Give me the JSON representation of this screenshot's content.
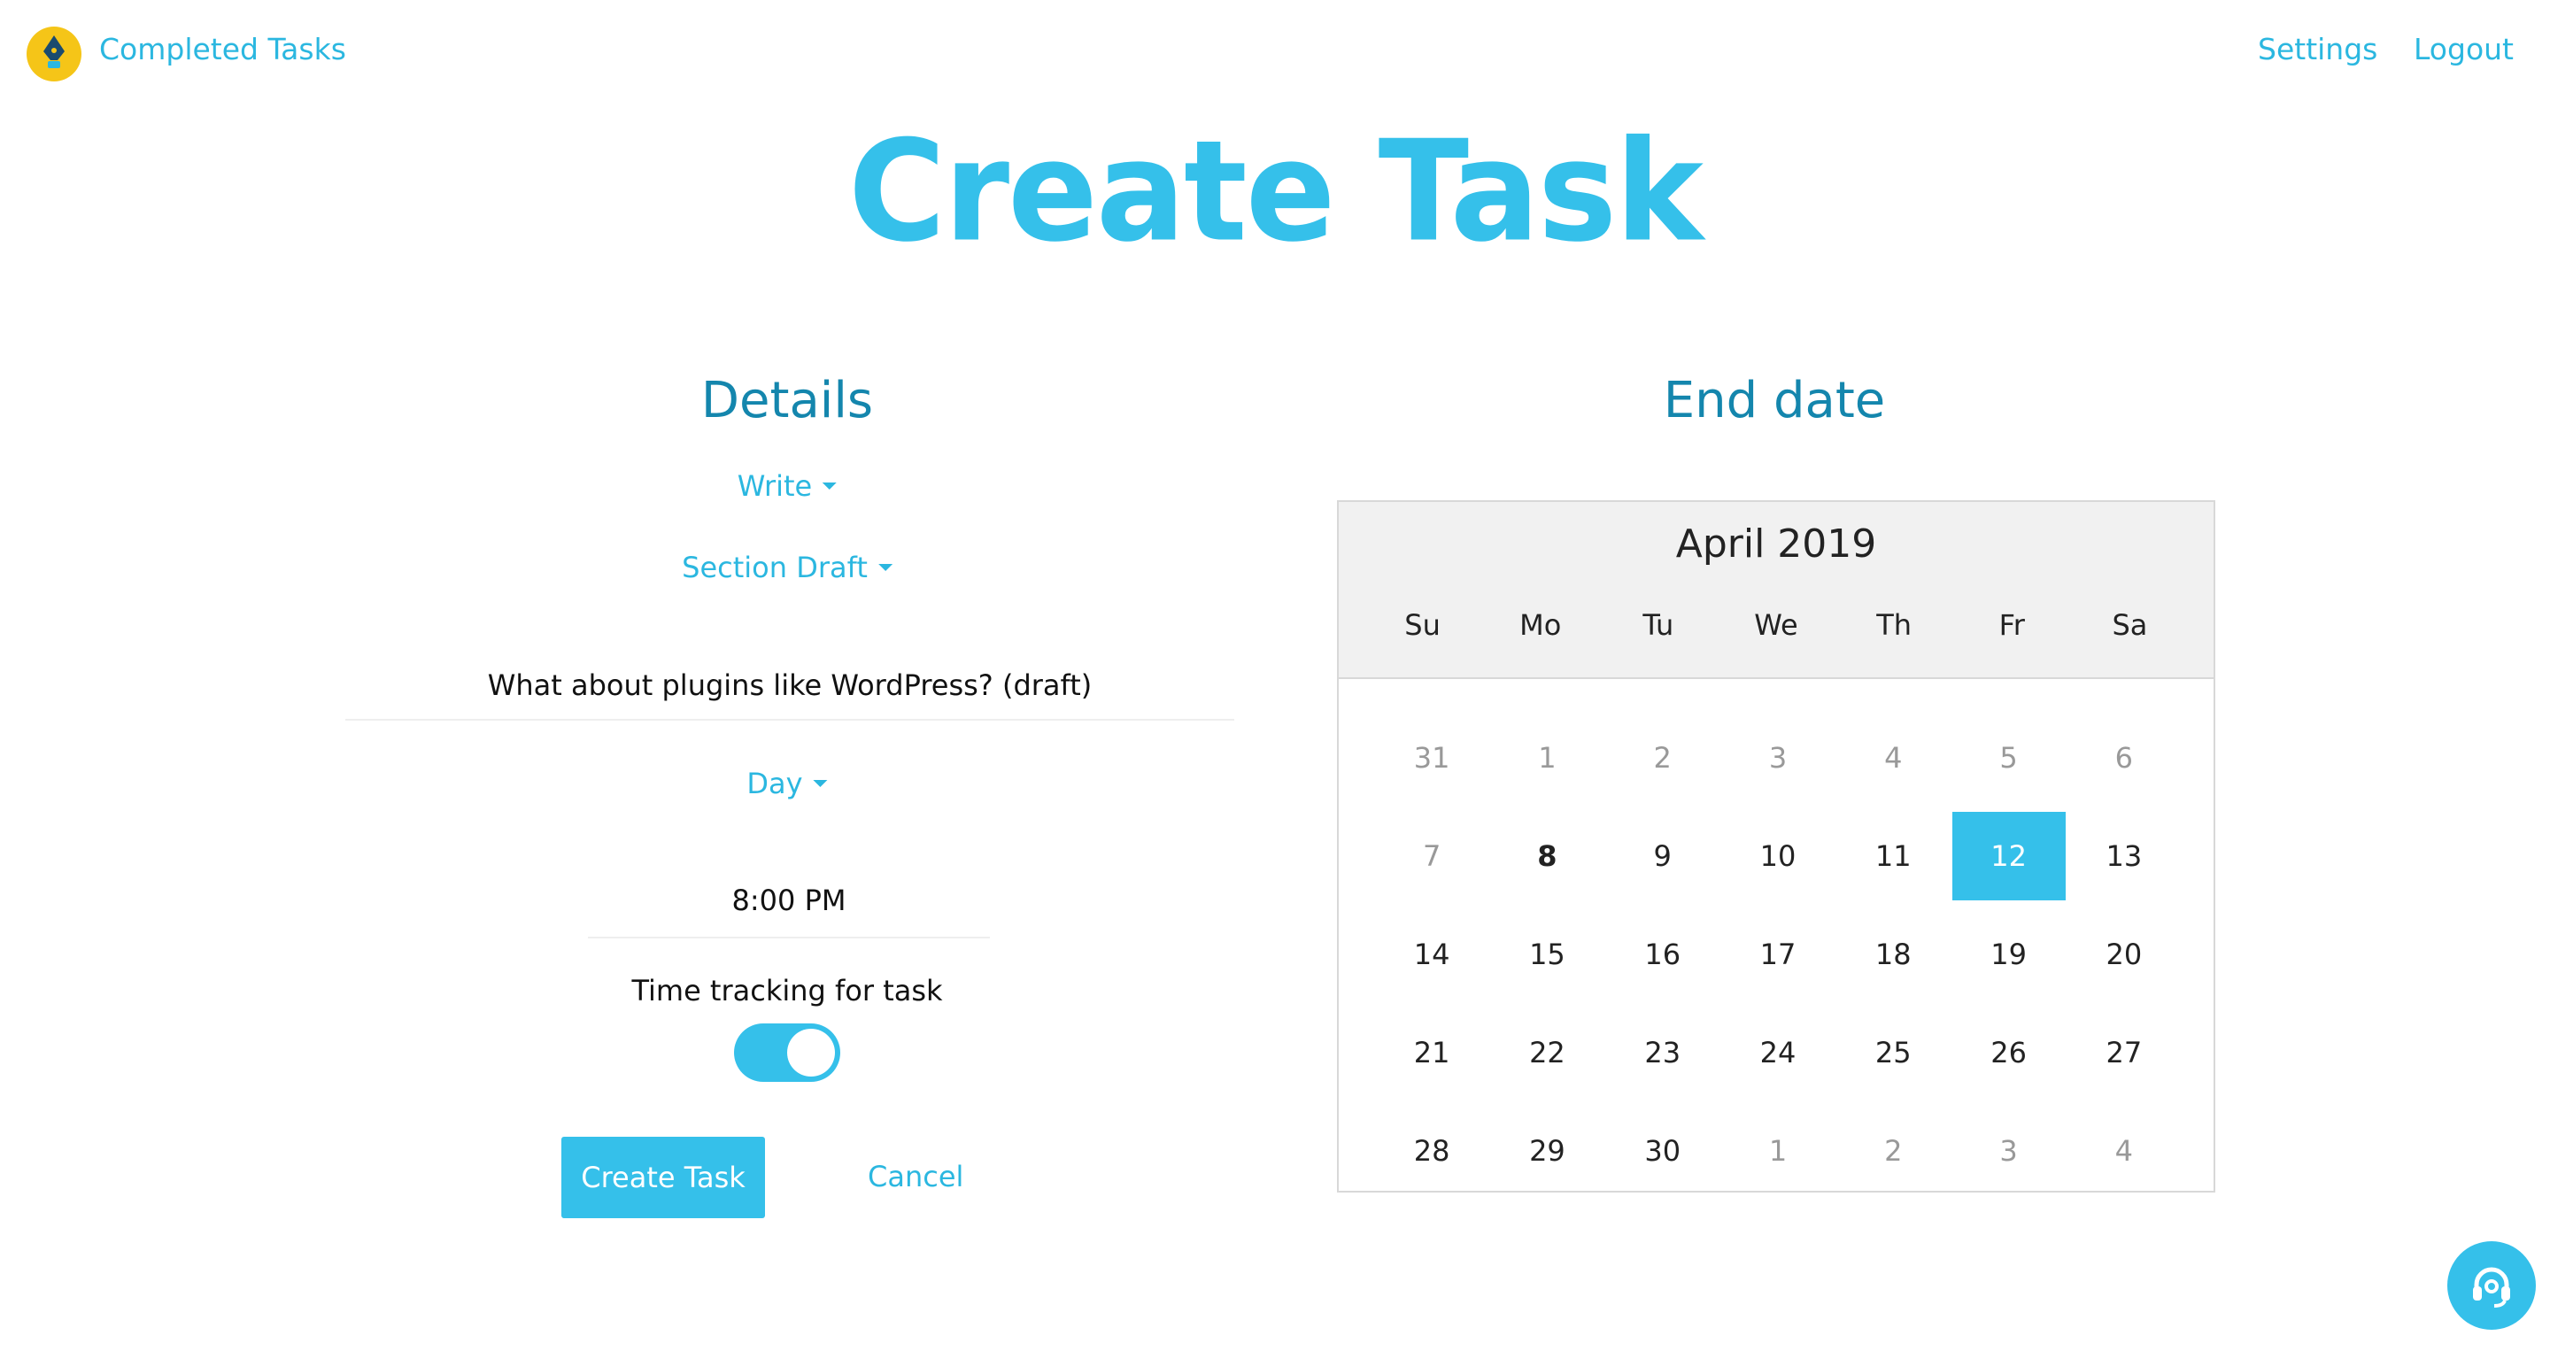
{
  "nav": {
    "completed_tasks": "Completed Tasks",
    "settings": "Settings",
    "logout": "Logout"
  },
  "page_title": "Create Task",
  "details": {
    "heading": "Details",
    "project_dropdown": "Write",
    "type_dropdown": "Section Draft",
    "task_name_value": "What about plugins like WordPress? (draft)",
    "period_dropdown": "Day",
    "time_value": "8:00 PM",
    "time_tracking_label": "Time tracking for task",
    "time_tracking_enabled": true,
    "create_button": "Create Task",
    "cancel_link": "Cancel"
  },
  "end_date": {
    "heading": "End date",
    "month_label": "April 2019",
    "weekdays": [
      "Su",
      "Mo",
      "Tu",
      "We",
      "Th",
      "Fr",
      "Sa"
    ],
    "days": [
      {
        "d": "31",
        "muted": true
      },
      {
        "d": "1",
        "muted": true
      },
      {
        "d": "2",
        "muted": true
      },
      {
        "d": "3",
        "muted": true
      },
      {
        "d": "4",
        "muted": true
      },
      {
        "d": "5",
        "muted": true
      },
      {
        "d": "6",
        "muted": true
      },
      {
        "d": "7",
        "muted": true
      },
      {
        "d": "8",
        "today": true
      },
      {
        "d": "9"
      },
      {
        "d": "10"
      },
      {
        "d": "11"
      },
      {
        "d": "12",
        "selected": true
      },
      {
        "d": "13"
      },
      {
        "d": "14"
      },
      {
        "d": "15"
      },
      {
        "d": "16"
      },
      {
        "d": "17"
      },
      {
        "d": "18"
      },
      {
        "d": "19"
      },
      {
        "d": "20"
      },
      {
        "d": "21"
      },
      {
        "d": "22"
      },
      {
        "d": "23"
      },
      {
        "d": "24"
      },
      {
        "d": "25"
      },
      {
        "d": "26"
      },
      {
        "d": "27"
      },
      {
        "d": "28"
      },
      {
        "d": "29"
      },
      {
        "d": "30"
      },
      {
        "d": "1",
        "muted": true
      },
      {
        "d": "2",
        "muted": true
      },
      {
        "d": "3",
        "muted": true
      },
      {
        "d": "4",
        "muted": true
      }
    ]
  },
  "colors": {
    "accent": "#35c0ea",
    "link": "#2bb7e0",
    "heading": "#1486ad",
    "logo": "#f5c518"
  },
  "icons": {
    "logo": "pen-nib-icon",
    "caret": "caret-down-icon",
    "help": "headset-icon"
  }
}
